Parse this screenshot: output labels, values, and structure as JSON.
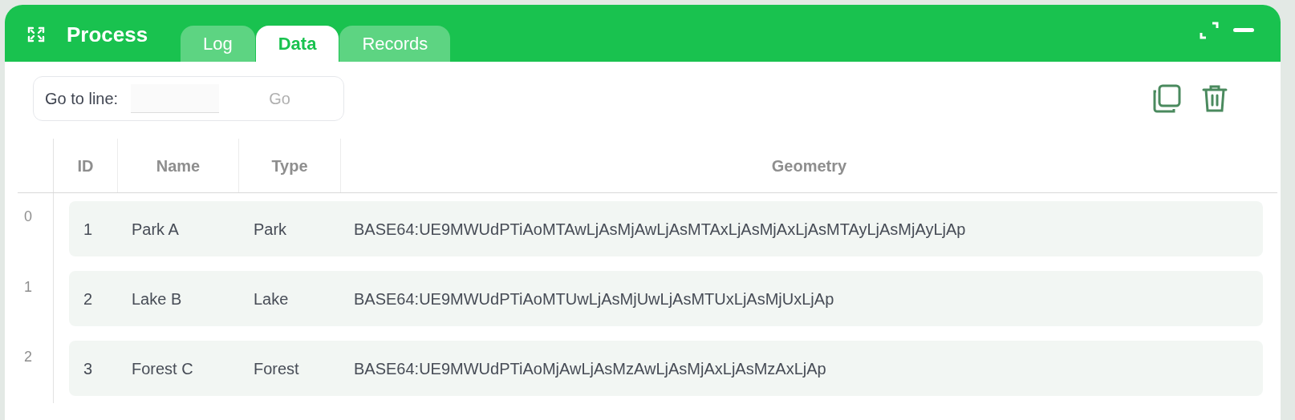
{
  "window": {
    "title": "Process"
  },
  "tabs": [
    {
      "label": "Log",
      "selected": false
    },
    {
      "label": "Data",
      "selected": true
    },
    {
      "label": "Records",
      "selected": false
    }
  ],
  "goto": {
    "label": "Go to line:",
    "button": "Go"
  },
  "table": {
    "columns": [
      "ID",
      "Name",
      "Type",
      "Geometry"
    ],
    "rows": [
      {
        "index": "0",
        "cells": [
          "1",
          "Park A",
          "Park",
          "BASE64:UE9MWUdPTiAoMTAwLjAsMjAwLjAsMTAxLjAsMjAxLjAsMTAyLjAsMjAyLjAp"
        ]
      },
      {
        "index": "1",
        "cells": [
          "2",
          "Lake B",
          "Lake",
          "BASE64:UE9MWUdPTiAoMTUwLjAsMjUwLjAsMTUxLjAsMjUxLjAp"
        ]
      },
      {
        "index": "2",
        "cells": [
          "3",
          "Forest C",
          "Forest",
          "BASE64:UE9MWUdPTiAoMjAwLjAsMzAwLjAsMjAxLjAsMzAxLjAp"
        ]
      }
    ]
  }
}
